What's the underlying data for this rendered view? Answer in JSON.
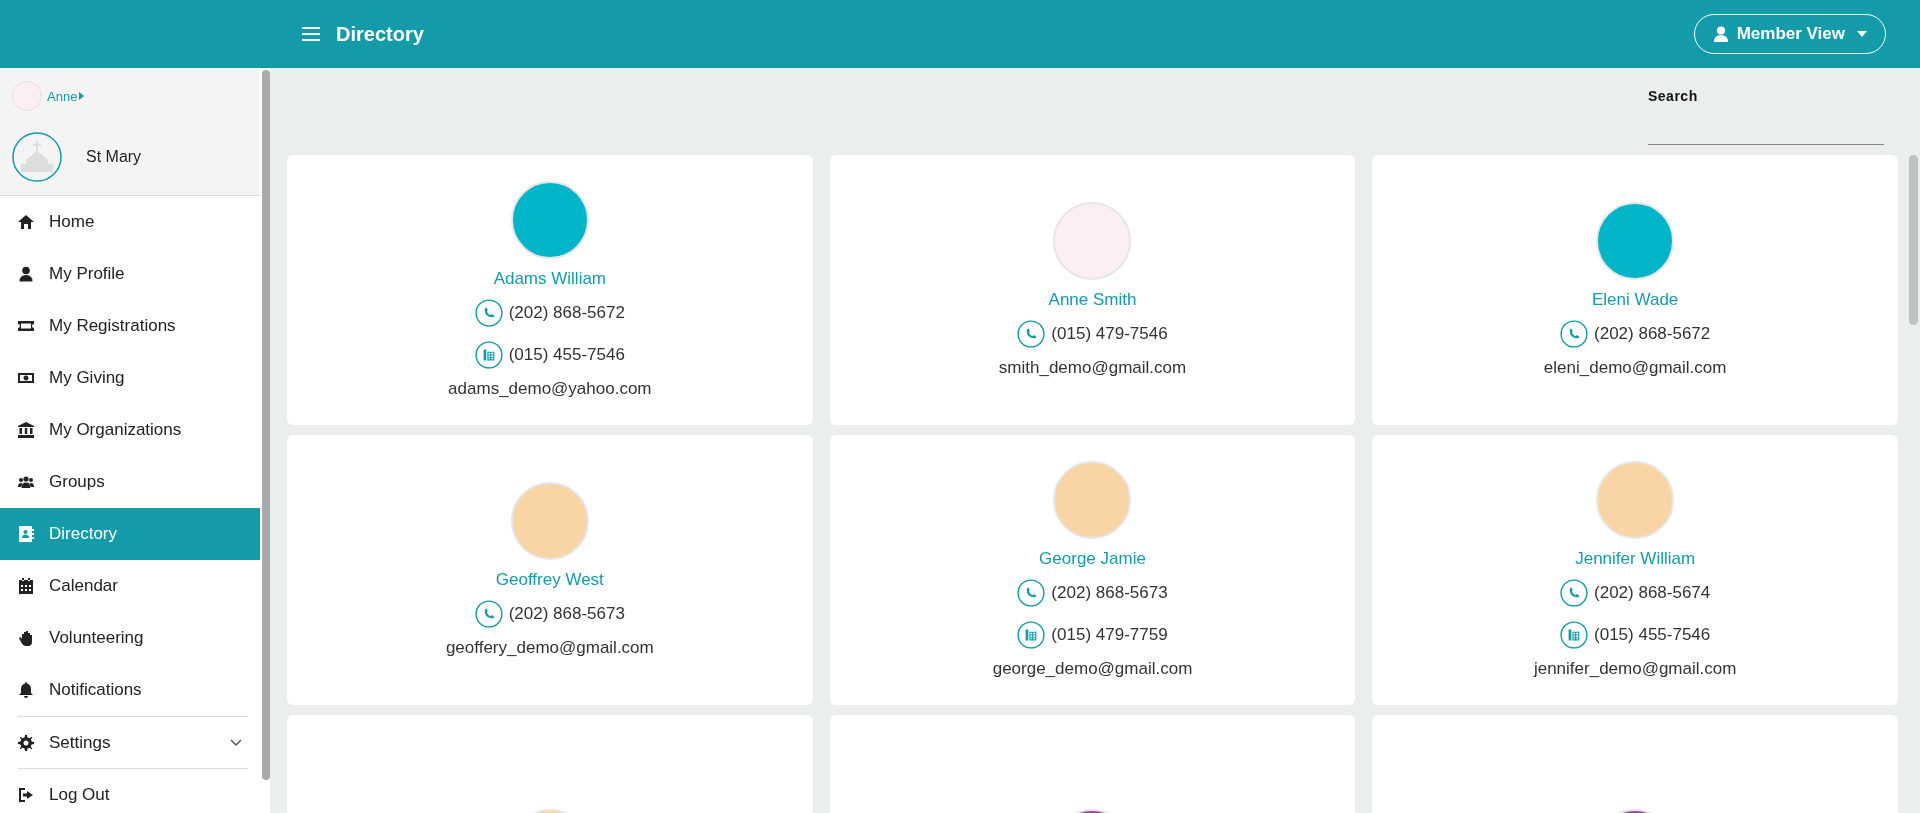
{
  "header": {
    "title": "Directory",
    "view_button": "Member View"
  },
  "sidebar": {
    "user": "Anne",
    "organization": "St Mary",
    "items": [
      {
        "label": "Home",
        "kind": "home",
        "selected": false
      },
      {
        "label": "My Profile",
        "kind": "user",
        "selected": false
      },
      {
        "label": "My Registrations",
        "kind": "ticket",
        "selected": false
      },
      {
        "label": "My Giving",
        "kind": "money",
        "selected": false
      },
      {
        "label": "My Organizations",
        "kind": "bank",
        "selected": false
      },
      {
        "label": "Groups",
        "kind": "users",
        "selected": false
      },
      {
        "label": "Directory",
        "kind": "contact",
        "selected": true
      },
      {
        "label": "Calendar",
        "kind": "calendar",
        "selected": false
      },
      {
        "label": "Volunteering",
        "kind": "hand",
        "selected": false
      },
      {
        "label": "Notifications",
        "kind": "bell",
        "selected": false
      },
      {
        "label": "Settings",
        "kind": "gear",
        "selected": false,
        "expanded": false
      },
      {
        "label": "Log Out",
        "kind": "logout",
        "selected": false
      }
    ]
  },
  "search": {
    "label": "Search"
  },
  "contacts": [
    {
      "name": "Adams William",
      "phone": "(202) 868-5672",
      "fax": "(015) 455-7546",
      "email": "adams_demo@yahoo.com",
      "color": "#00b5c8"
    },
    {
      "name": "Anne Smith",
      "phone": "(015) 479-7546",
      "email": "smith_demo@gmail.com",
      "color": "#fbeff5"
    },
    {
      "name": "Eleni Wade",
      "phone": "(202) 868-5672",
      "email": "eleni_demo@gmail.com",
      "color": "#00b5c8"
    },
    {
      "name": "Geoffrey West",
      "phone": "(202) 868-5673",
      "email": "geoffery_demo@gmail.com",
      "color": "#f9d5a5"
    },
    {
      "name": "George Jamie",
      "phone": "(202) 868-5673",
      "fax": "(015) 479-7759",
      "email": "george_demo@gmail.com",
      "color": "#f9d5a5"
    },
    {
      "name": "Jennifer William",
      "phone": "(202) 868-5674",
      "fax": "(015) 455-7546",
      "email": "jennifer_demo@gmail.com",
      "color": "#f9d5a5"
    },
    {
      "color": "#f9d5a5"
    },
    {
      "color": "#8e4a94"
    },
    {
      "color": "#8e4a94"
    }
  ]
}
